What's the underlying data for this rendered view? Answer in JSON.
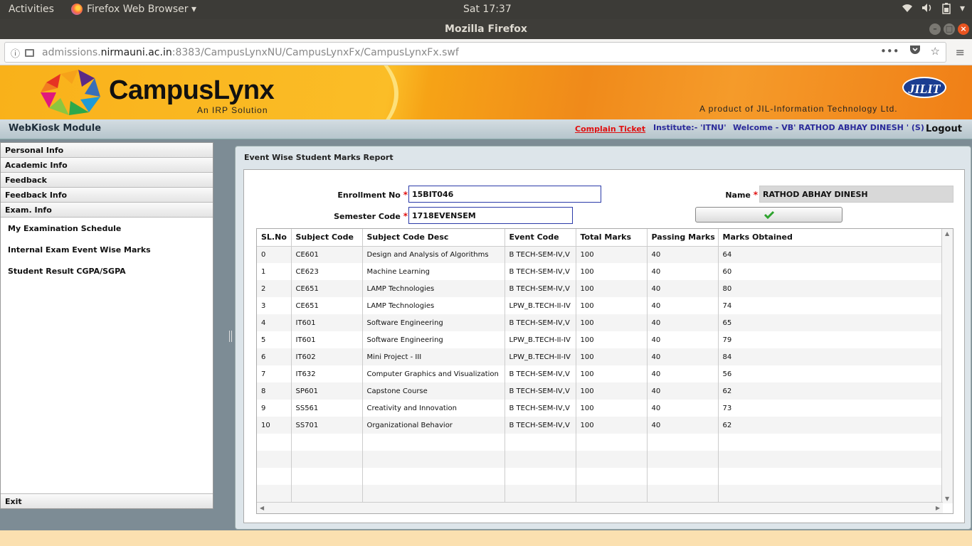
{
  "system_bar": {
    "activities": "Activities",
    "app_menu": "Firefox Web Browser ▾",
    "clock": "Sat 17:37"
  },
  "window": {
    "title": "Mozilla Firefox"
  },
  "address_bar": {
    "url_host_prefix": "admissions.",
    "url_host_main": "nirmauni.ac.in",
    "url_rest": ":8383/CampusLynxNU/CampusLynxFx/CampusLynxFx.swf"
  },
  "banner": {
    "brand": "CampusLynx",
    "tagline": "An IRP Solution",
    "partner_logo": "JILIT",
    "product_line": "A product of JIL-Information Technology Ltd."
  },
  "module_bar": {
    "module": "WebKiosk Module",
    "complain_ticket": "Complain Ticket",
    "institute": "Institute:-  'ITNU'",
    "welcome": "Welcome - VB' RATHOD ABHAY DINESH '  (S)",
    "logout": "Logout"
  },
  "sidebar": {
    "sections": [
      "Personal Info",
      "Academic Info",
      "Feedback",
      "Feedback Info",
      "Exam. Info"
    ],
    "sub_items": [
      "My Examination Schedule",
      "Internal Exam Event Wise Marks",
      "Student Result CGPA/SGPA"
    ],
    "exit": "Exit"
  },
  "report": {
    "title": "Event Wise Student Marks Report",
    "enrollment_label": "Enrollment No",
    "enrollment_value": "15BIT046",
    "semester_label": "Semester Code",
    "semester_value": "1718EVENSEM",
    "name_label": "Name",
    "name_value": "RATHOD ABHAY DINESH",
    "required_mark": "*",
    "columns": [
      "SL.No",
      "Subject Code",
      "Subject Code Desc",
      "Event Code",
      "Total Marks",
      "Passing Marks",
      "Marks Obtained"
    ],
    "rows": [
      [
        "0",
        "CE601",
        "Design and Analysis of Algorithms",
        "B TECH-SEM-IV,V",
        "100",
        "40",
        "64"
      ],
      [
        "1",
        "CE623",
        "Machine Learning",
        "B TECH-SEM-IV,V",
        "100",
        "40",
        "60"
      ],
      [
        "2",
        "CE651",
        "LAMP Technologies",
        "B TECH-SEM-IV,V",
        "100",
        "40",
        "80"
      ],
      [
        "3",
        "CE651",
        "LAMP Technologies",
        "LPW_B.TECH-II-IV",
        "100",
        "40",
        "74"
      ],
      [
        "4",
        "IT601",
        "Software Engineering",
        "B TECH-SEM-IV,V",
        "100",
        "40",
        "65"
      ],
      [
        "5",
        "IT601",
        "Software Engineering",
        "LPW_B.TECH-II-IV",
        "100",
        "40",
        "79"
      ],
      [
        "6",
        "IT602",
        "Mini Project - III",
        "LPW_B.TECH-II-IV",
        "100",
        "40",
        "84"
      ],
      [
        "7",
        "IT632",
        "Computer Graphics and Visualization",
        "B TECH-SEM-IV,V",
        "100",
        "40",
        "56"
      ],
      [
        "8",
        "SP601",
        "Capstone Course",
        "B TECH-SEM-IV,V",
        "100",
        "40",
        "62"
      ],
      [
        "9",
        "SS561",
        "Creativity and Innovation",
        "B TECH-SEM-IV,V",
        "100",
        "40",
        "73"
      ],
      [
        "10",
        "SS701",
        "Organizational Behavior",
        "B TECH-SEM-IV,V",
        "100",
        "40",
        "62"
      ]
    ],
    "empty_rows": 4
  },
  "colors": {
    "accent_red": "#e01010",
    "link_blue": "#2a2a9a",
    "banner_orange": "#f9b11a",
    "input_border": "#2b3aa8"
  }
}
